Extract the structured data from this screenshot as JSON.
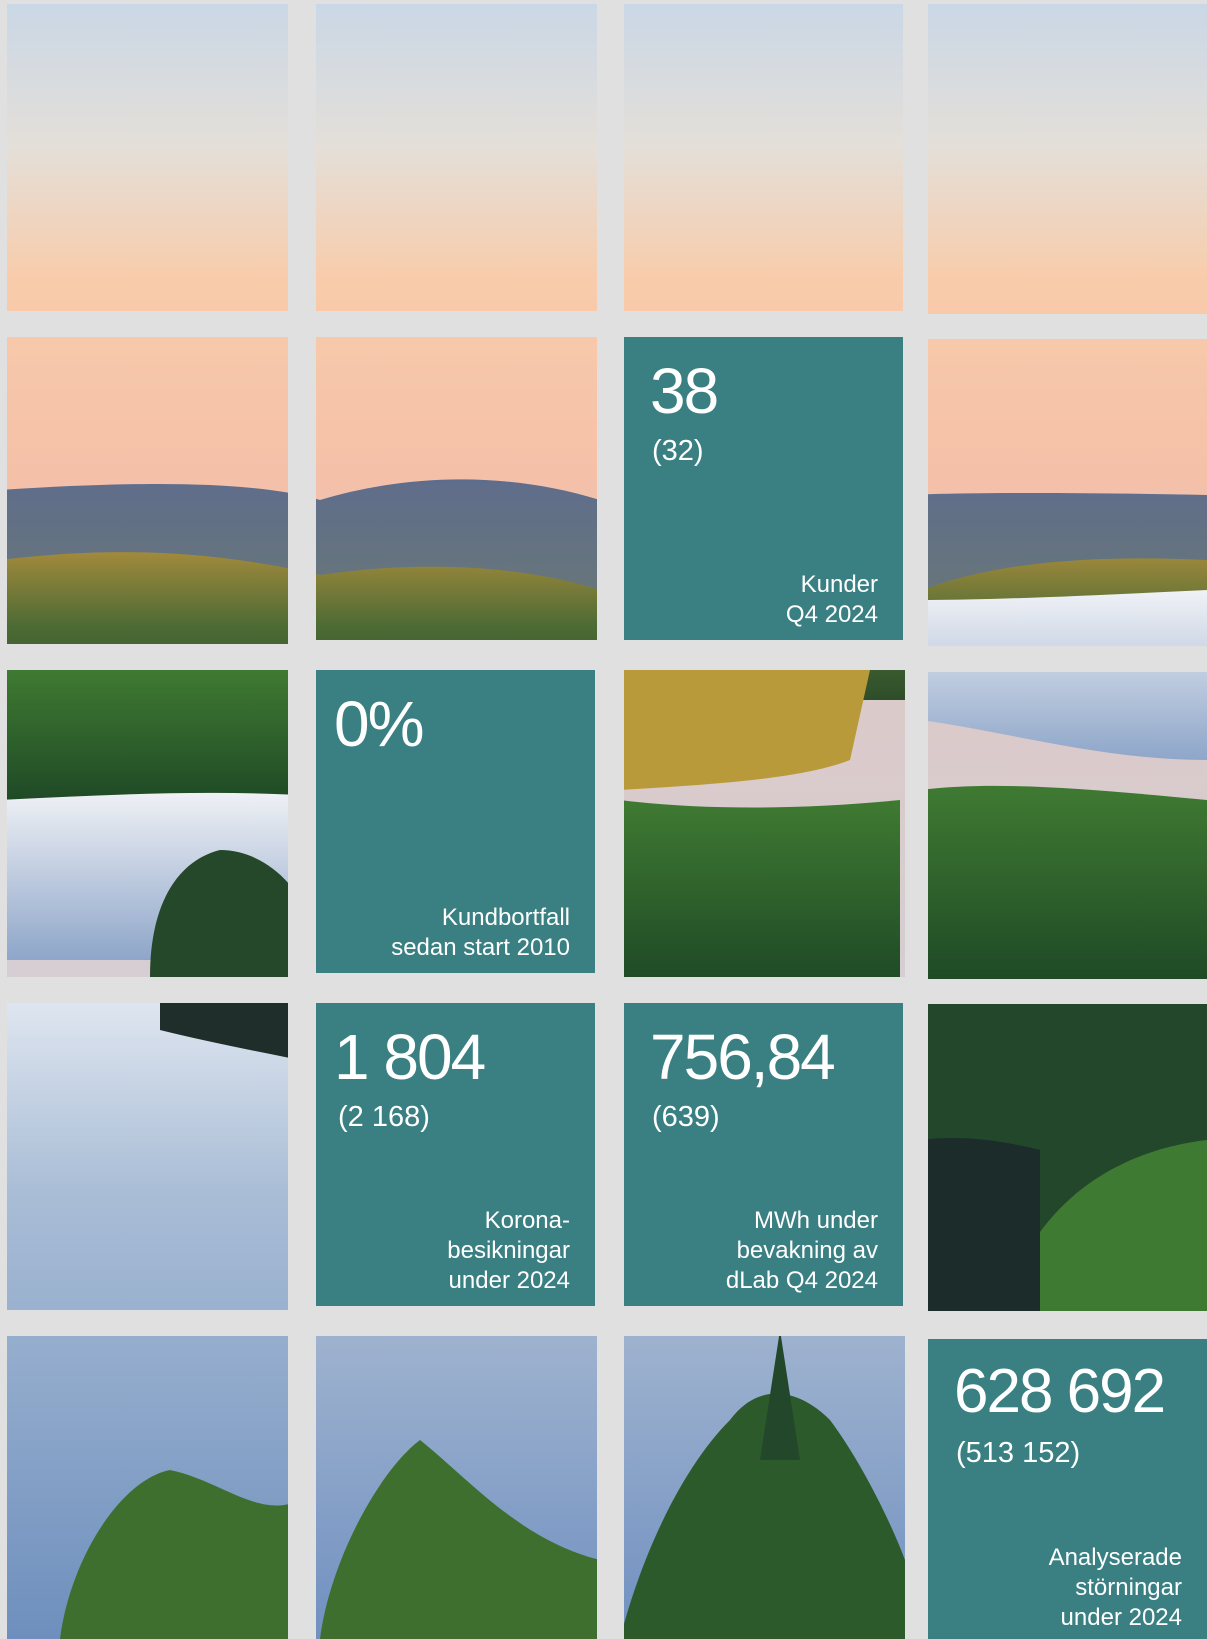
{
  "colors": {
    "background": "#e0e0e0",
    "stat_tile": "#3a8083",
    "stat_text": "#ffffff"
  },
  "stats": [
    {
      "value": "38",
      "previous": "(32)",
      "label": "Kunder\nQ4 2024"
    },
    {
      "value": "0%",
      "previous": "",
      "label": "Kundbortfall\nsedan start 2010"
    },
    {
      "value": "1 804",
      "previous": "(2 168)",
      "label": "Korona-\nbesikningar\nunder 2024"
    },
    {
      "value": "756,84",
      "previous": "(639)",
      "label": "MWh under\nbevakning av\ndLab Q4 2024"
    },
    {
      "value": "628 692",
      "previous": "(513 152)",
      "label": "Analyserade\nstörningar\nunder 2024"
    }
  ]
}
